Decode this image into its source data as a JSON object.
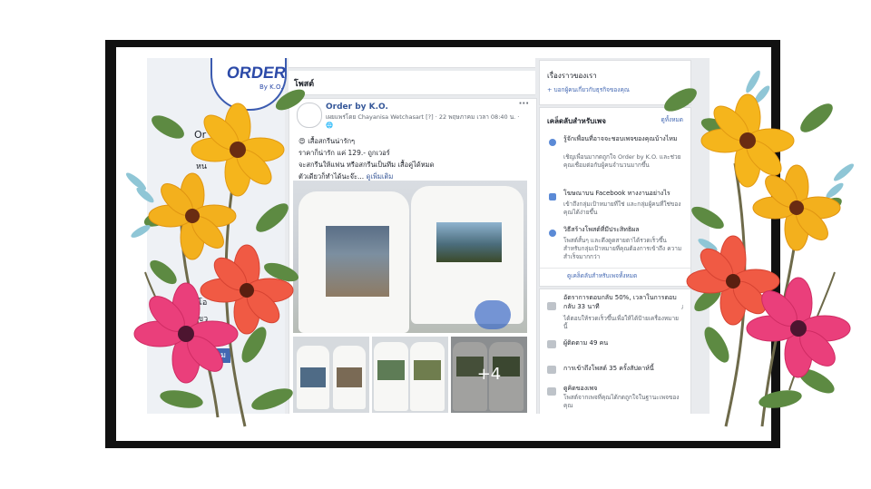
{
  "page": {
    "logo_text": "ORDER",
    "logo_sub": "By K.O.",
    "left_letters": [
      "Or",
      "หน",
      "โอ",
      "ขว"
    ],
    "left_button_label": "ขม"
  },
  "center": {
    "posts_header": "โพสต์",
    "post": {
      "page_name": "Order by K.O.",
      "meta": "เผยแพร่โดย Chayanisa Wetchasart [?] · 22 พฤษภาคม เวลา 08:40 น. · 🌐",
      "menu_icon": "···",
      "line1": "😍 เสื้อสกรีนน่ารักๆ",
      "line2": "ราคาก็น่ารัก แค่ 129.- ถูกเวอร์",
      "line3": "จะสกรีนให้แฟน หรือสกรีนเป็นทีม เสื้อคู่ได้หมด",
      "line4": "ตัวเดียวก็ทำได้นะจ๊ะ...",
      "see_more": "ดูเพิ่มเติม",
      "more_photos": "+4"
    }
  },
  "right": {
    "story_title": "เรื่องราวของเรา",
    "story_link": "+ บอกผู้คนเกี่ยวกับธุรกิจของคุณ",
    "tips_title": "เคล็ดลับสำหรับเพจ",
    "tips_see_all": "ดูทั้งหมด",
    "tips": [
      {
        "icon": "bulb-icon",
        "title": "รู้จักเพื่อนที่อาจจะชอบเพจของคุณบ้างไหม",
        "desc": "เชิญเพื่อนมากดถูกใจ Order by K.O. และช่วยคุณเชื่อมต่อกับผู้คนจำนวนมากขึ้น"
      },
      {
        "icon": "chart-icon",
        "title": "โฆษณาบน Facebook ทางงานอย่างไร",
        "desc": "เข้าถึงกลุ่มเป้าหมายที่ใช่ และกลุ่มผู้คนที่ใช่ของคุณได้ง่ายขึ้น"
      },
      {
        "icon": "share-icon",
        "title": "วิธีสร้างโพสต์ที่มีประสิทธิผล",
        "desc": "โพสต์สั้นๆ และดึงดูดสายตาได้รวดเร็วขึ้น สำหรับกลุ่มเป้าหมายที่คุณต้องการเข้าถึง ความสำเร็จมากกว่า"
      }
    ],
    "tips_footer": "ดูเคล็ดลับสำหรับเพจทั้งหมด",
    "stats": [
      {
        "icon": "chat-icon",
        "text": "อัตราการตอบกลับ 50%, เวลาในการตอบกลับ 33 นาที",
        "sub": "ได้ตอบให้รวดเร็วขึ้นเพื่อให้ได้ป้ายเครื่องหมายนี้"
      },
      {
        "icon": "people-icon",
        "text": "ผู้ติดตาม 49 คน",
        "sub": ""
      },
      {
        "icon": "bar-chart-icon",
        "text": "การเข้าถึงโพสต์ 35 ครั้งสัปดาห์นี้",
        "sub": ""
      },
      {
        "icon": "page-icon",
        "text": "ดูคิดของเพจ",
        "sub": "โพสต์จากเพจที่คุณได้กดถูกใจในฐานะเพจของคุณ"
      }
    ],
    "info_icon": "i"
  },
  "colors": {
    "frame": "#111111",
    "fb_bg": "#e9ebee",
    "link": "#365899",
    "accent": "#4267b2"
  }
}
